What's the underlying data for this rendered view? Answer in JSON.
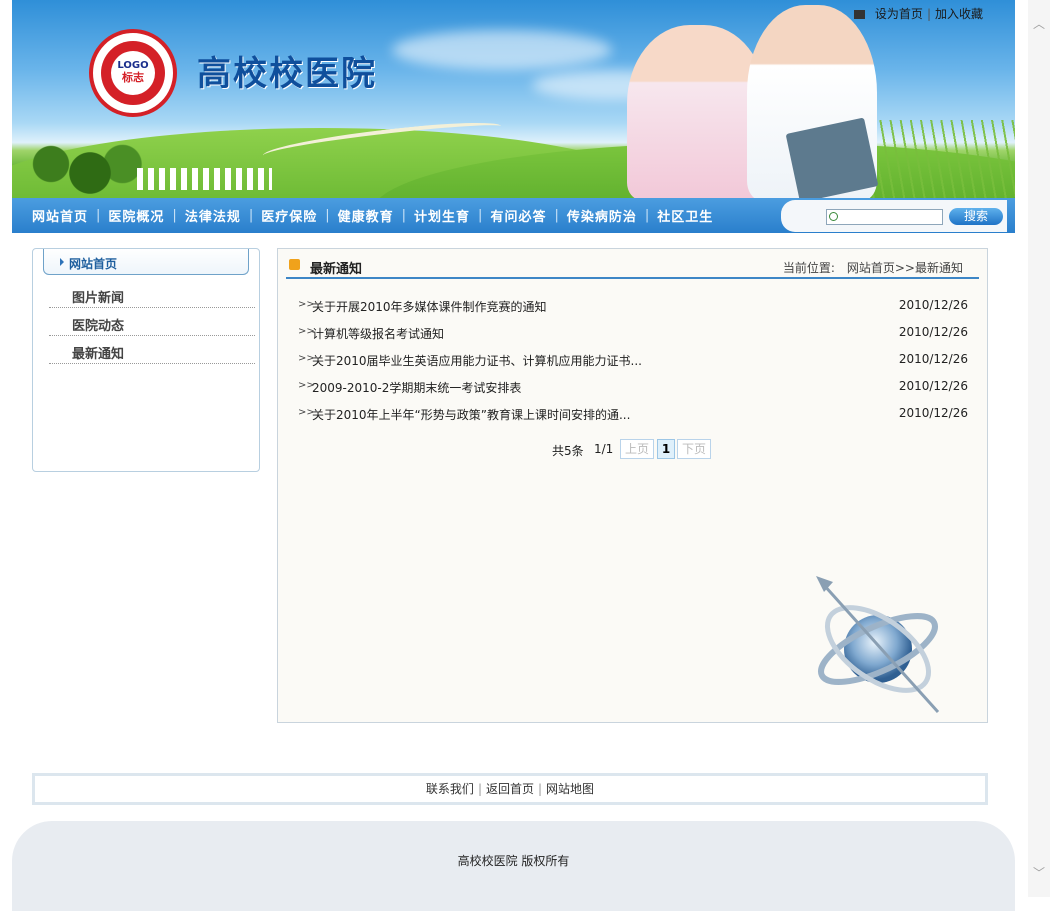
{
  "header": {
    "logo_line1": "LOGO",
    "logo_line2": "标志",
    "site_title": "高校校医院",
    "set_home": "设为首页",
    "add_favorite": "加入收藏",
    "link_sep": "|"
  },
  "nav": {
    "items": [
      "网站首页",
      "医院概况",
      "法律法规",
      "医疗保险",
      "健康教育",
      "计划生育",
      "有问必答",
      "传染病防治",
      "社区卫生"
    ],
    "separator": "|",
    "search_button": "搜索",
    "search_value": ""
  },
  "sidebar": {
    "active": "网站首页",
    "items": [
      "图片新闻",
      "医院动态",
      "最新通知"
    ]
  },
  "main": {
    "title": "最新通知",
    "breadcrumb_label": "当前位置:",
    "breadcrumb_path": "网站首页>>最新通知",
    "row_marker": ">>",
    "rows": [
      {
        "title": "关于开展2010年多媒体课件制作竞赛的通知",
        "date": "2010/12/26"
      },
      {
        "title": "计算机等级报名考试通知",
        "date": "2010/12/26"
      },
      {
        "title": "关于2010届毕业生英语应用能力证书、计算机应用能力证书...",
        "date": "2010/12/26"
      },
      {
        "title": "2009-2010-2学期期末统一考试安排表",
        "date": "2010/12/26"
      },
      {
        "title": "关于2010年上半年“形势与政策”教育课上课时间安排的通...",
        "date": "2010/12/26"
      }
    ],
    "pager": {
      "total": "共5条",
      "page_of": "1/1",
      "prev": "上页",
      "current": "1",
      "next": "下页"
    }
  },
  "footer": {
    "links": [
      "联系我们",
      "返回首页",
      "网站地图"
    ],
    "separator": "|",
    "copyright": "高校校医院  版权所有"
  },
  "colors": {
    "nav_blue": "#2a7fcc",
    "title_blue": "#0f4f9c",
    "logo_red": "#d42027",
    "footer_gray": "#e8ecf1"
  },
  "icons": {
    "scroll_up": "︿",
    "scroll_down": "﹀"
  }
}
